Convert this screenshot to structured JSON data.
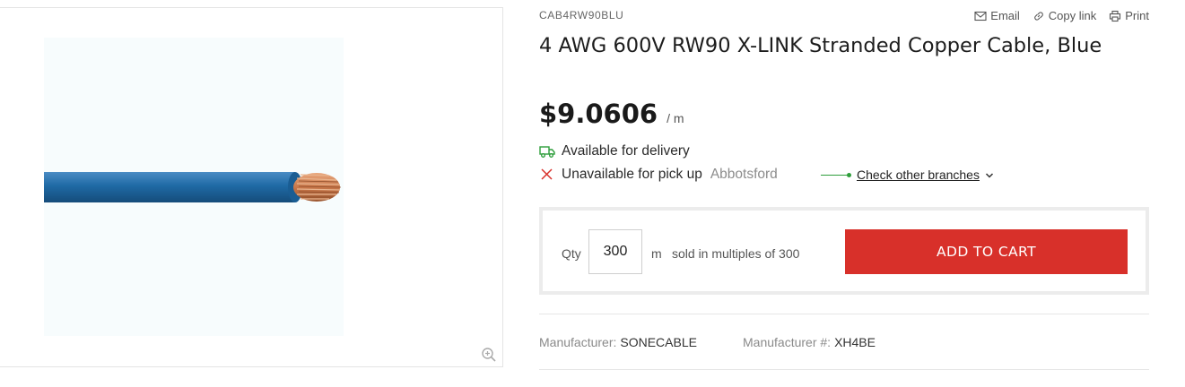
{
  "product": {
    "sku": "CAB4RW90BLU",
    "title": "4 AWG 600V RW90 X-LINK Stranded Copper Cable, Blue",
    "price": "$9.0606",
    "price_unit": "/ m"
  },
  "actions": {
    "email": "Email",
    "copy_link": "Copy link",
    "print": "Print"
  },
  "availability": {
    "delivery": "Available for delivery",
    "pickup": "Unavailable for pick up",
    "branch": "Abbotsford",
    "check_branches": "Check other branches"
  },
  "cart": {
    "qty_label": "Qty",
    "qty_value": "300",
    "qty_unit": "m",
    "multiples_text": "sold in multiples of 300",
    "add_to_cart": "ADD TO CART"
  },
  "specs": {
    "manufacturer_label": "Manufacturer:",
    "manufacturer_value": "SONECABLE",
    "manufacturer_num_label": "Manufacturer #:",
    "manufacturer_num_value": "XH4BE"
  },
  "colors": {
    "accent_red": "#d8302a",
    "available_green": "#2e9e3b",
    "cable_blue": "#1f6aa5",
    "copper": "#c8774a"
  },
  "icons": [
    "email-icon",
    "link-icon",
    "print-icon",
    "delivery-truck-icon",
    "close-icon",
    "chevron-down-icon",
    "zoom-icon"
  ]
}
